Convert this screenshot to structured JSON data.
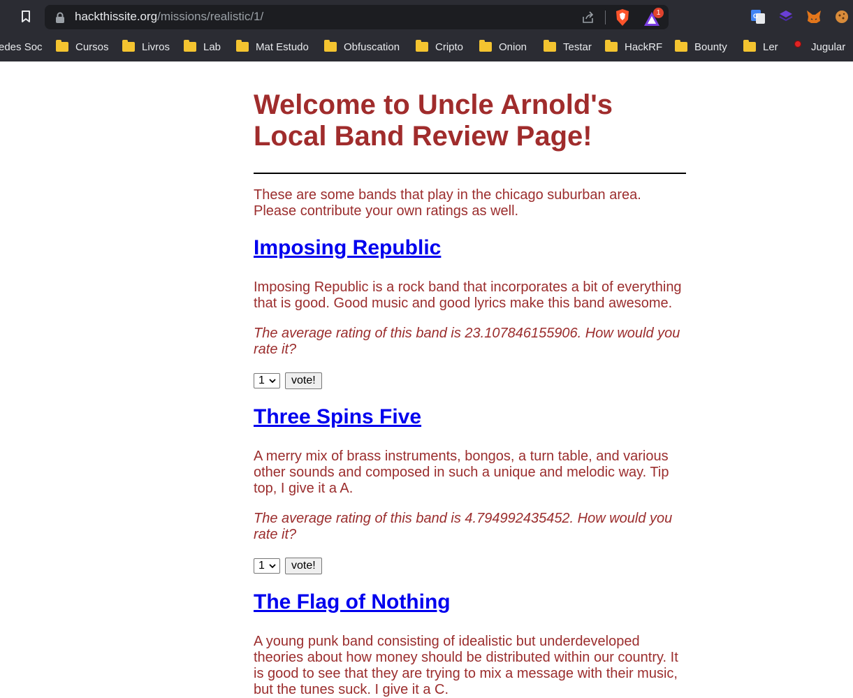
{
  "browser": {
    "url_host": "hackthissite.org",
    "url_path": "/missions/realistic/1/",
    "rewards_badge": "1",
    "bookmarks": [
      {
        "label": "edes Soc",
        "icon": "none"
      },
      {
        "label": "Cursos",
        "icon": "folder-icon"
      },
      {
        "label": "Livros",
        "icon": "folder-icon"
      },
      {
        "label": "Lab",
        "icon": "folder-icon"
      },
      {
        "label": "Mat Estudo",
        "icon": "folder-icon"
      },
      {
        "label": "Obfuscation",
        "icon": "folder-icon"
      },
      {
        "label": "Cripto",
        "icon": "folder-icon"
      },
      {
        "label": "Onion",
        "icon": "folder-icon"
      },
      {
        "label": "Testar",
        "icon": "folder-icon"
      },
      {
        "label": "HackRF",
        "icon": "folder-icon"
      },
      {
        "label": "Bounty",
        "icon": "folder-icon"
      },
      {
        "label": "Ler",
        "icon": "folder-icon"
      },
      {
        "label": "Jugular",
        "icon": "pin-icon"
      }
    ]
  },
  "page": {
    "title": "Welcome to Uncle Arnold's Local Band Review Page!",
    "intro": "These are some bands that play in the chicago suburban area. Please contribute your own ratings as well.",
    "vote_label": "vote!",
    "select_value": "1",
    "bands": [
      {
        "name": "Imposing Republic",
        "description": "Imposing Republic is a rock band that incorporates a bit of everything that is good. Good music and good lyrics make this band awesome.",
        "rating_text": "The average rating of this band is 23.107846155906. How would you rate it?"
      },
      {
        "name": "Three Spins Five",
        "description": "A merry mix of brass instruments, bongos, a turn table, and various other sounds and composed in such a unique and melodic way. Tip top, I give it a A.",
        "rating_text": "The average rating of this band is 4.794992435452. How would you rate it?"
      },
      {
        "name": "The Flag of Nothing",
        "description": "A young punk band consisting of idealistic but underdeveloped theories about how money should be distributed within our country. It is good to see that they are trying to mix a message with their music, but the tunes suck. I give it a C.",
        "rating_text": ""
      }
    ]
  },
  "colors": {
    "chrome_bg": "#2b2c33",
    "urlbar_bg": "#1c1d21",
    "text_red": "#9b2d2d",
    "link_blue": "#0000ee",
    "folder_yellow": "#f4c430"
  }
}
